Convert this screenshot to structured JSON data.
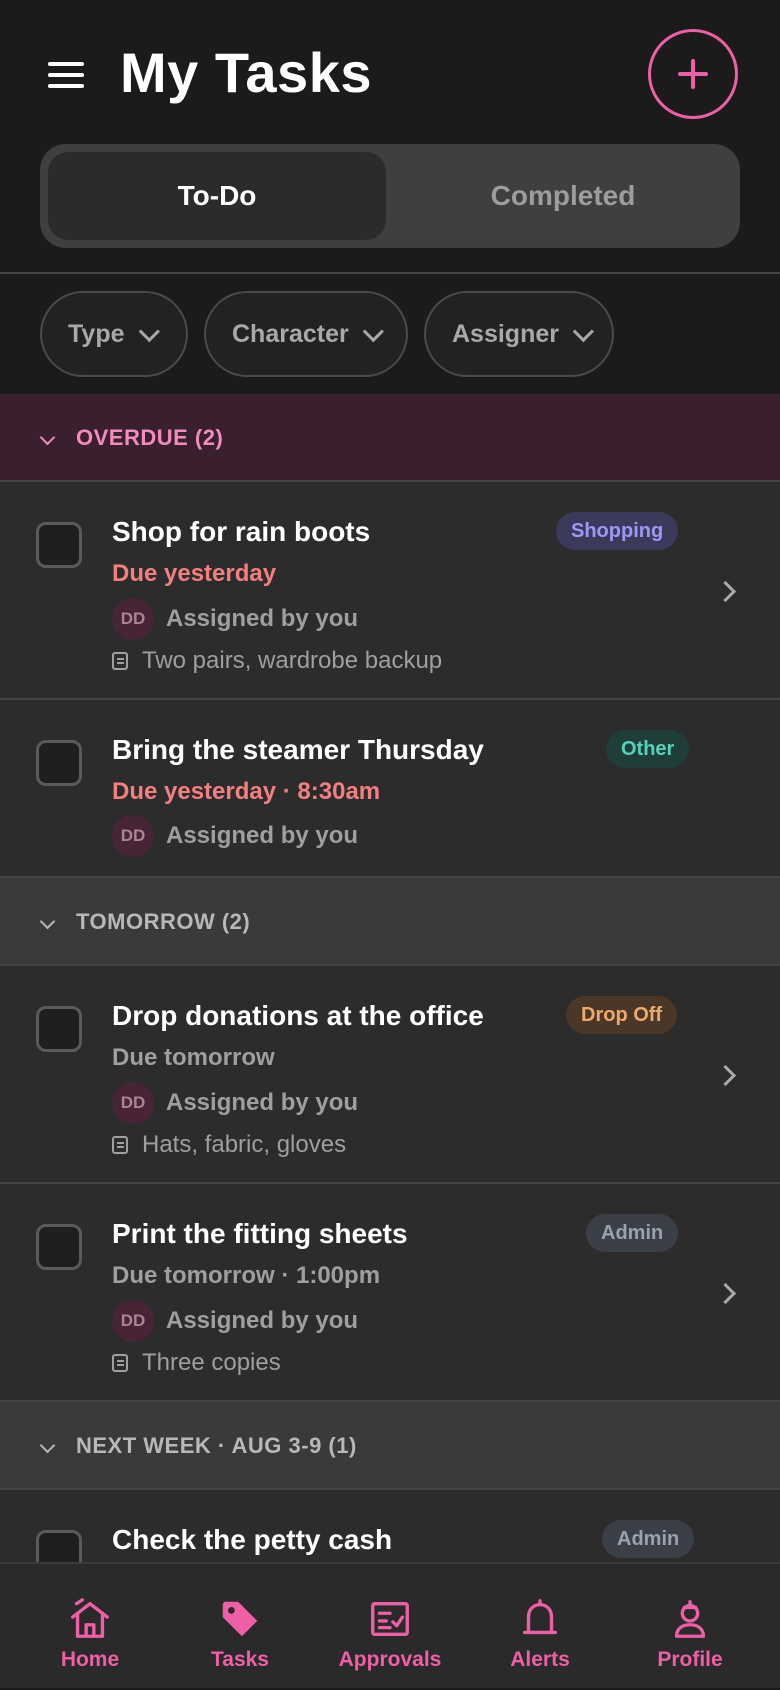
{
  "header": {
    "title": "My Tasks"
  },
  "segments": {
    "active": "To-Do",
    "inactive": "Completed"
  },
  "filters": [
    {
      "label": "Type"
    },
    {
      "label": "Character"
    },
    {
      "label": "Assigner"
    }
  ],
  "sections": [
    {
      "label": "OVERDUE (2)"
    },
    {
      "label": "TOMORROW (2)"
    },
    {
      "label": "NEXT WEEK · AUG 3-9 (1)"
    }
  ],
  "tasks": [
    {
      "title": "Shop for rain boots",
      "due": "Due yesterday",
      "badge": "Shopping",
      "avatar": "DD",
      "assigned": "Assigned by you",
      "note": "Two pairs, wardrobe backup"
    },
    {
      "title": "Bring the steamer Thursday",
      "due": "Due yesterday · 8:30am",
      "badge": "Other",
      "avatar": "DD",
      "assigned": "Assigned by you"
    },
    {
      "title": "Drop donations at the office",
      "due": "Due tomorrow",
      "badge": "Drop Off",
      "avatar": "DD",
      "assigned": "Assigned by you",
      "note": "Hats, fabric, gloves"
    },
    {
      "title": "Print the fitting sheets",
      "due": "Due tomorrow · 1:00pm",
      "badge": "Admin",
      "avatar": "DD",
      "assigned": "Assigned by you",
      "note": "Three copies"
    },
    {
      "title": "Check the petty cash",
      "badge": "Admin"
    }
  ],
  "nav": [
    {
      "label": "Home",
      "icon": "home-icon"
    },
    {
      "label": "Tasks",
      "icon": "tag-icon"
    },
    {
      "label": "Approvals",
      "icon": "approvals-icon"
    },
    {
      "label": "Alerts",
      "icon": "bell-icon"
    },
    {
      "label": "Profile",
      "icon": "profile-icon"
    }
  ],
  "colors": {
    "accent": "#ef5fa7",
    "overdue_bg": "#3a1f2f",
    "overdue_text": "#f38bbf",
    "due_overdue": "#f37f7f"
  }
}
